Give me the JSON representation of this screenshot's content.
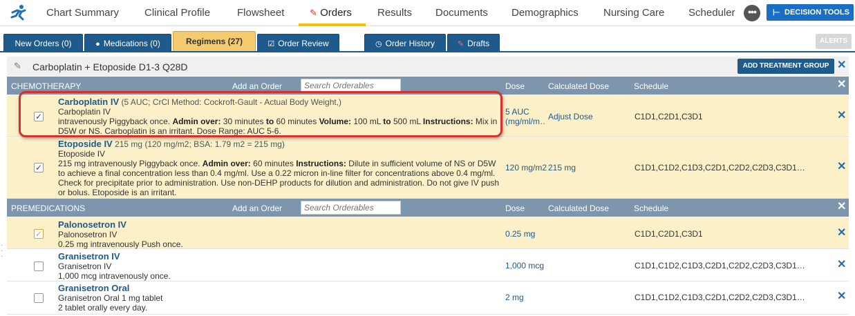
{
  "nav": {
    "items": [
      "Chart Summary",
      "Clinical Profile",
      "Flowsheet",
      "Orders",
      "Results",
      "Documents",
      "Demographics",
      "Nursing Care",
      "Scheduler"
    ],
    "more": "•••",
    "decision_tools": "DECISION TOOLS"
  },
  "subtabs": {
    "new_orders": "New Orders (0)",
    "medications": "Medications (0)",
    "regimens": "Regimens (27)",
    "order_review": "Order Review",
    "order_history": "Order History",
    "drafts": "Drafts",
    "alerts": "ALERTS"
  },
  "regimen": {
    "title": "Carboplatin + Etoposide D1-3 Q28D",
    "add_group": "ADD TREATMENT GROUP",
    "close": "✕"
  },
  "columns": {
    "add_order": "Add an Order",
    "search_placeholder": "Search Orderables",
    "dose": "Dose",
    "calculated_dose": "Calculated Dose",
    "schedule": "Schedule"
  },
  "chemotherapy": {
    "title": "CHEMOTHERAPY",
    "rows": [
      {
        "name": "Carboplatin IV",
        "name_extra": "(5 AUC; CrCl Method: Cockroft-Gault - Actual Body Weight,)",
        "generic": "Carboplatin IV",
        "line1": "intravenously Piggyback once.",
        "admin_over_label": "Admin over:",
        "admin_over_value": "30 minutes",
        "to_label": "to",
        "to_value": "60 minutes",
        "volume_label": "Volume:",
        "volume_value": "100 mL",
        "to2_label": "to",
        "to2_value": "500 mL",
        "instructions_label": "Instructions:",
        "instructions_value": "Mix in D5W or NS. Carboplatin is an irritant. Dose Range: AUC 5-6.",
        "dose": "5 AUC (mg/ml/m…",
        "calc": "Adjust Dose",
        "schedule": "C1D1,C2D1,C3D1",
        "checked": "✓"
      },
      {
        "name": "Etoposide IV",
        "name_extra": "215 mg (120 mg/m2; BSA: 1.79 m2 = 215 mg)",
        "generic": "Etoposide IV",
        "line1": "215 mg intravenously Piggyback once.",
        "admin_over_label": "Admin over:",
        "admin_over_value": "60 minutes",
        "instructions_label": "Instructions:",
        "instructions_value": "Dilute in sufficient volume of NS or D5W to achieve a final concentration less than 0.4 mg/ml. Use a 0.22 micron in-line filter for concentrations above 0.4 mg/ml. Check for precipitate prior to administration. Use non-DEHP products for dilution and administration. Do not give IV push or bolus. Etoposide is an irritant.",
        "dose": "120 mg/m2",
        "calc": "215 mg",
        "schedule": "C1D1,C1D2,C1D3,C2D1,C2D2,C2D3,C3D1…",
        "checked": "✓"
      }
    ]
  },
  "premedications": {
    "title": "PREMEDICATIONS",
    "rows": [
      {
        "name": "Palonosetron IV",
        "generic": "Palonosetron IV",
        "instructions": "0.25 mg intravenously Push once.",
        "dose": "0.25 mg",
        "schedule": "C1D1,C2D1,C3D1",
        "checked": "✓"
      },
      {
        "name": "Granisetron IV",
        "generic": "Granisetron IV",
        "instructions": "1,000 mcg intravenously once.",
        "dose": "1,000 mcg",
        "schedule": "C1D1,C1D2,C1D3,C2D1,C2D2,C2D3,C3D1…",
        "checked": ""
      },
      {
        "name": "Granisetron Oral",
        "generic": "Granisetron Oral 1 mg tablet",
        "instructions": "2 tablet orally every day.",
        "dose": "2 mg",
        "schedule": "C1D1,C1D2,C1D3,C2D1,C2D2,C2D3,C3D1…",
        "checked": ""
      }
    ]
  },
  "colors": {
    "nav_accent": "#f2c200",
    "tab_blue": "#1e5b8c",
    "tab_active": "#f6ca6e",
    "section_header": "#7d96ae",
    "selected_row": "#fcf0c8",
    "link": "#1c5a8c",
    "highlight": "#d0342c"
  }
}
